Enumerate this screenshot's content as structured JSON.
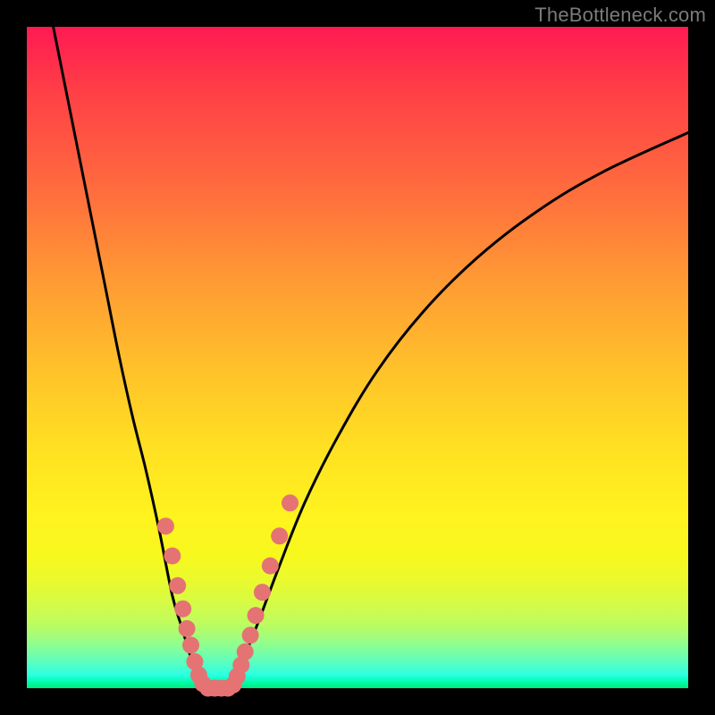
{
  "watermark": "TheBottleneck.com",
  "colors": {
    "frame": "#000000",
    "curve": "#000000",
    "marker_fill": "#e57373",
    "marker_stroke": "#d06565",
    "gradient_top": "#ff1a52",
    "gradient_bottom": "#00e87a"
  },
  "chart_data": {
    "type": "line",
    "title": "",
    "xlabel": "",
    "ylabel": "",
    "xlim": [
      0,
      100
    ],
    "ylim": [
      0,
      100
    ],
    "grid": false,
    "legend": false,
    "series": [
      {
        "name": "left_branch",
        "x": [
          4,
          6,
          8,
          10,
          12,
          14,
          16,
          18,
          20,
          22,
          23.5,
          25,
          26,
          27
        ],
        "values": [
          100,
          90,
          80,
          70,
          60,
          50,
          41,
          33,
          24,
          14,
          9,
          4,
          1.5,
          0
        ]
      },
      {
        "name": "valley_floor",
        "x": [
          27,
          28,
          29,
          30,
          31
        ],
        "values": [
          0,
          0,
          0,
          0,
          0
        ]
      },
      {
        "name": "right_branch",
        "x": [
          31,
          32,
          33,
          35,
          38,
          42,
          47,
          53,
          60,
          68,
          77,
          87,
          100
        ],
        "values": [
          0,
          2,
          5,
          10,
          18,
          28,
          38,
          48,
          57,
          65,
          72,
          78,
          84
        ]
      }
    ],
    "markers": [
      {
        "x": 21.0,
        "y": 24.5
      },
      {
        "x": 22.0,
        "y": 20.0
      },
      {
        "x": 22.8,
        "y": 15.5
      },
      {
        "x": 23.6,
        "y": 12.0
      },
      {
        "x": 24.2,
        "y": 9.0
      },
      {
        "x": 24.8,
        "y": 6.5
      },
      {
        "x": 25.4,
        "y": 4.0
      },
      {
        "x": 26.0,
        "y": 2.0
      },
      {
        "x": 26.6,
        "y": 0.7
      },
      {
        "x": 27.4,
        "y": 0.0
      },
      {
        "x": 28.4,
        "y": 0.0
      },
      {
        "x": 29.4,
        "y": 0.0
      },
      {
        "x": 30.4,
        "y": 0.0
      },
      {
        "x": 31.2,
        "y": 0.5
      },
      {
        "x": 31.8,
        "y": 1.8
      },
      {
        "x": 32.4,
        "y": 3.5
      },
      {
        "x": 33.0,
        "y": 5.5
      },
      {
        "x": 33.8,
        "y": 8.0
      },
      {
        "x": 34.6,
        "y": 11.0
      },
      {
        "x": 35.6,
        "y": 14.5
      },
      {
        "x": 36.8,
        "y": 18.5
      },
      {
        "x": 38.2,
        "y": 23.0
      },
      {
        "x": 39.8,
        "y": 28.0
      }
    ]
  }
}
